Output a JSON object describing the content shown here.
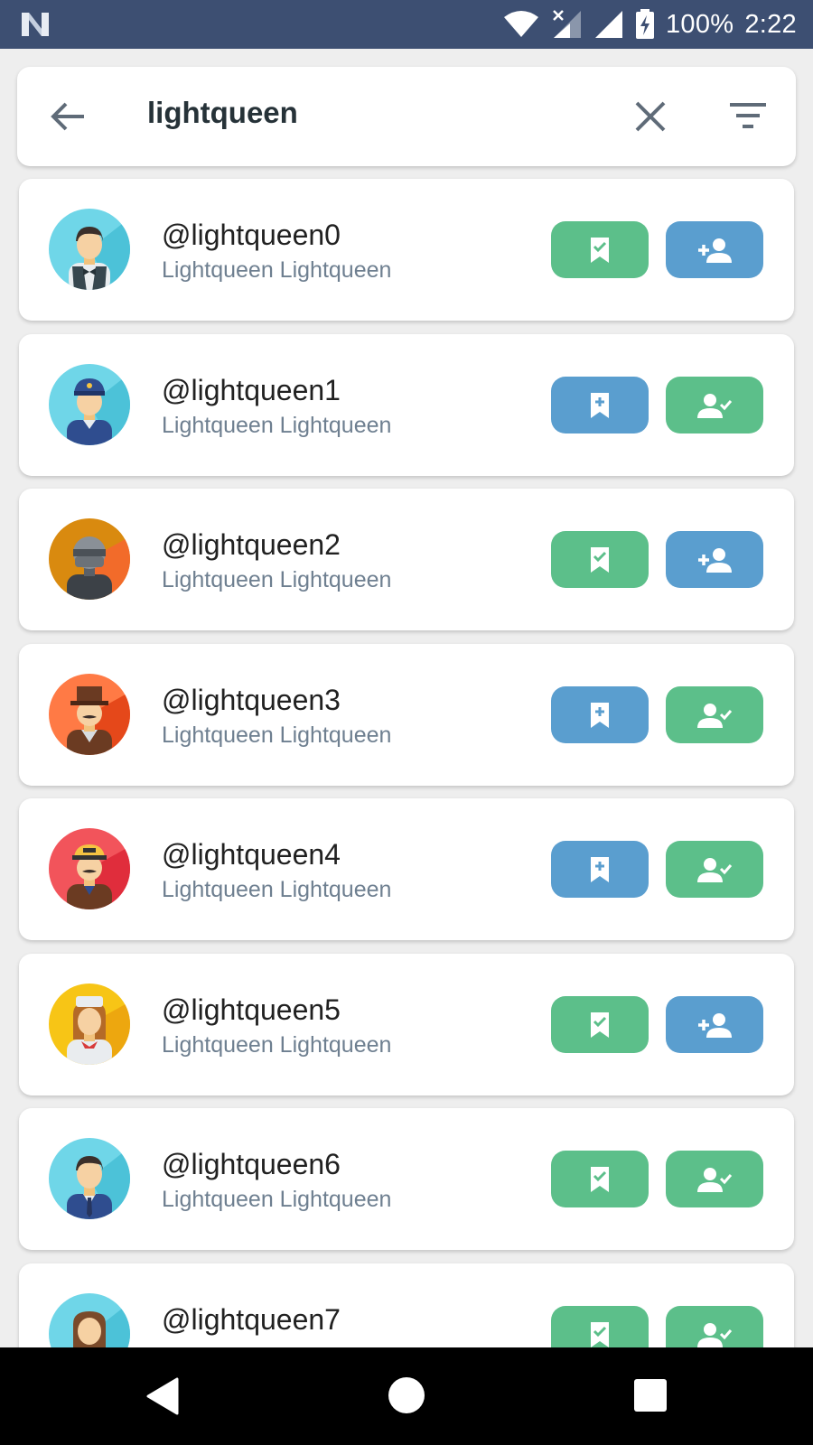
{
  "status_bar": {
    "battery": "100%",
    "time": "2:22"
  },
  "search": {
    "query": "lightqueen"
  },
  "results": [
    {
      "username": "@lightqueen0",
      "name": "Lightqueen Lightqueen",
      "bookmark": "saved",
      "follow": "add"
    },
    {
      "username": "@lightqueen1",
      "name": "Lightqueen Lightqueen",
      "bookmark": "add",
      "follow": "following"
    },
    {
      "username": "@lightqueen2",
      "name": "Lightqueen Lightqueen",
      "bookmark": "saved",
      "follow": "add"
    },
    {
      "username": "@lightqueen3",
      "name": "Lightqueen Lightqueen",
      "bookmark": "add",
      "follow": "following"
    },
    {
      "username": "@lightqueen4",
      "name": "Lightqueen Lightqueen",
      "bookmark": "add",
      "follow": "following"
    },
    {
      "username": "@lightqueen5",
      "name": "Lightqueen Lightqueen",
      "bookmark": "saved",
      "follow": "add"
    },
    {
      "username": "@lightqueen6",
      "name": "Lightqueen Lightqueen",
      "bookmark": "saved",
      "follow": "following"
    },
    {
      "username": "@lightqueen7",
      "name": "",
      "bookmark": "saved",
      "follow": "following"
    }
  ],
  "colors": {
    "status_bar": "#3d4f72",
    "active_green": "#5cbf8a",
    "action_blue": "#5a9ecf",
    "name_gray": "#6e7f90"
  },
  "icons": {
    "back": "arrow-left-icon",
    "clear": "close-icon",
    "filter": "filter-icon",
    "bookmark_saved": "bookmark-check-icon",
    "bookmark_add": "bookmark-plus-icon",
    "follow_add": "person-add-icon",
    "follow_done": "person-check-icon"
  }
}
